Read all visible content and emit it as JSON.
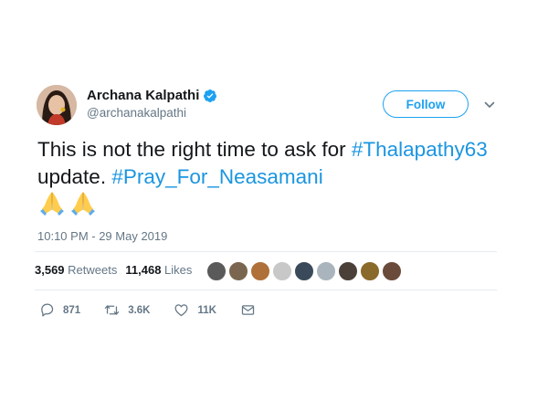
{
  "author": {
    "display_name": "Archana Kalpathi",
    "handle": "@archanakalpathi",
    "verified": true
  },
  "follow_button": {
    "label": "Follow"
  },
  "tweet": {
    "text_part1": "This is not the right time to ask for ",
    "hashtag1": "#Thalapathy63",
    "text_part2": " update. ",
    "hashtag2": "#Pray_For_Neasamani",
    "emojis": [
      "folded-hands",
      "folded-hands"
    ],
    "timestamp": "10:10 PM - 29 May 2019"
  },
  "stats": {
    "retweets_count": "3,569",
    "retweets_label": "Retweets",
    "likes_count": "11,468",
    "likes_label": "Likes"
  },
  "liker_avatars": [
    "#5a5a5a",
    "#7a6650",
    "#b0703a",
    "#c8c8c8",
    "#3a4a5a",
    "#aab4bc",
    "#4a4038",
    "#8a6a2a",
    "#6a4a3a"
  ],
  "actions": {
    "reply_count": "871",
    "retweet_count": "3.6K",
    "like_count": "11K"
  },
  "colors": {
    "accent": "#1da1f2",
    "hashtag": "#1b95e0",
    "secondary_text": "#657786"
  }
}
